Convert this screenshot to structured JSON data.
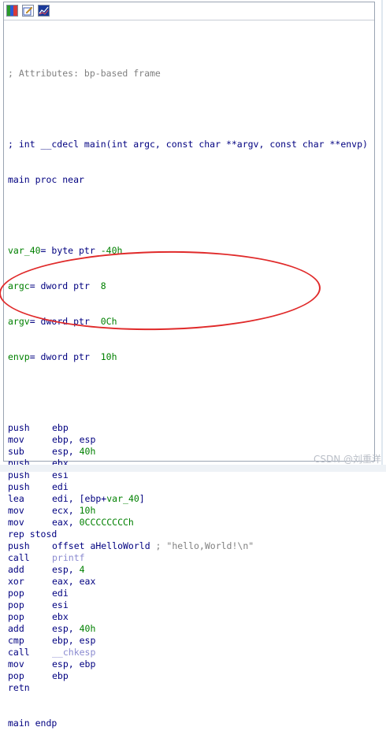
{
  "toolbar": {
    "icons": [
      "graph-view-icon",
      "edit-icon",
      "chart-icon"
    ]
  },
  "code": {
    "line_attr": "; Attributes: bp-based frame",
    "line_decl": "; int __cdecl main(int argc, const char **argv, const char **envp)",
    "line_proc": "main proc near",
    "var_40": {
      "name": "var_40",
      "eq": "= byte ptr ",
      "val": "-40h"
    },
    "argc": {
      "name": "argc",
      "eq": "= dword ptr  ",
      "val": "8"
    },
    "argv": {
      "name": "argv",
      "eq": "= dword ptr  ",
      "val": "0Ch"
    },
    "envp": {
      "name": "envp",
      "eq": "= dword ptr  ",
      "val": "10h"
    },
    "ins": [
      {
        "op": "push",
        "arg": "ebp"
      },
      {
        "op": "mov",
        "arg": "ebp, esp"
      },
      {
        "op": "sub",
        "arg": "esp, ",
        "num": "40h"
      },
      {
        "op": "push",
        "arg": "ebx"
      },
      {
        "op": "push",
        "arg": "esi"
      },
      {
        "op": "push",
        "arg": "edi"
      },
      {
        "op": "lea",
        "arg": "edi, [ebp+",
        "var": "var_40",
        "tail": "]"
      },
      {
        "op": "mov",
        "arg": "ecx, ",
        "num": "10h"
      },
      {
        "op": "mov",
        "arg": "eax, ",
        "num": "0CCCCCCCCh"
      },
      {
        "full": "rep stosd"
      },
      {
        "op": "push",
        "arg": "offset aHelloWorld",
        "comment": " ; \"hello,World!\\n\""
      },
      {
        "op": "call",
        "fn": "printf"
      },
      {
        "op": "add",
        "arg": "esp, ",
        "num": "4"
      },
      {
        "op": "xor",
        "arg": "eax, eax"
      },
      {
        "op": "pop",
        "arg": "edi"
      },
      {
        "op": "pop",
        "arg": "esi"
      },
      {
        "op": "pop",
        "arg": "ebx"
      },
      {
        "op": "add",
        "arg": "esp, ",
        "num": "40h"
      },
      {
        "op": "cmp",
        "arg": "ebp, esp"
      },
      {
        "op": "call",
        "fn": "__chkesp"
      },
      {
        "op": "mov",
        "arg": "esp, ebp"
      },
      {
        "op": "pop",
        "arg": "ebp"
      },
      {
        "full": "retn"
      }
    ],
    "line_endp": "main endp"
  },
  "watermark": "CSDN @刘重洋",
  "colors": {
    "annotation": "#e02a2a",
    "instruction": "#000080",
    "number": "#008000",
    "comment": "#808080"
  }
}
